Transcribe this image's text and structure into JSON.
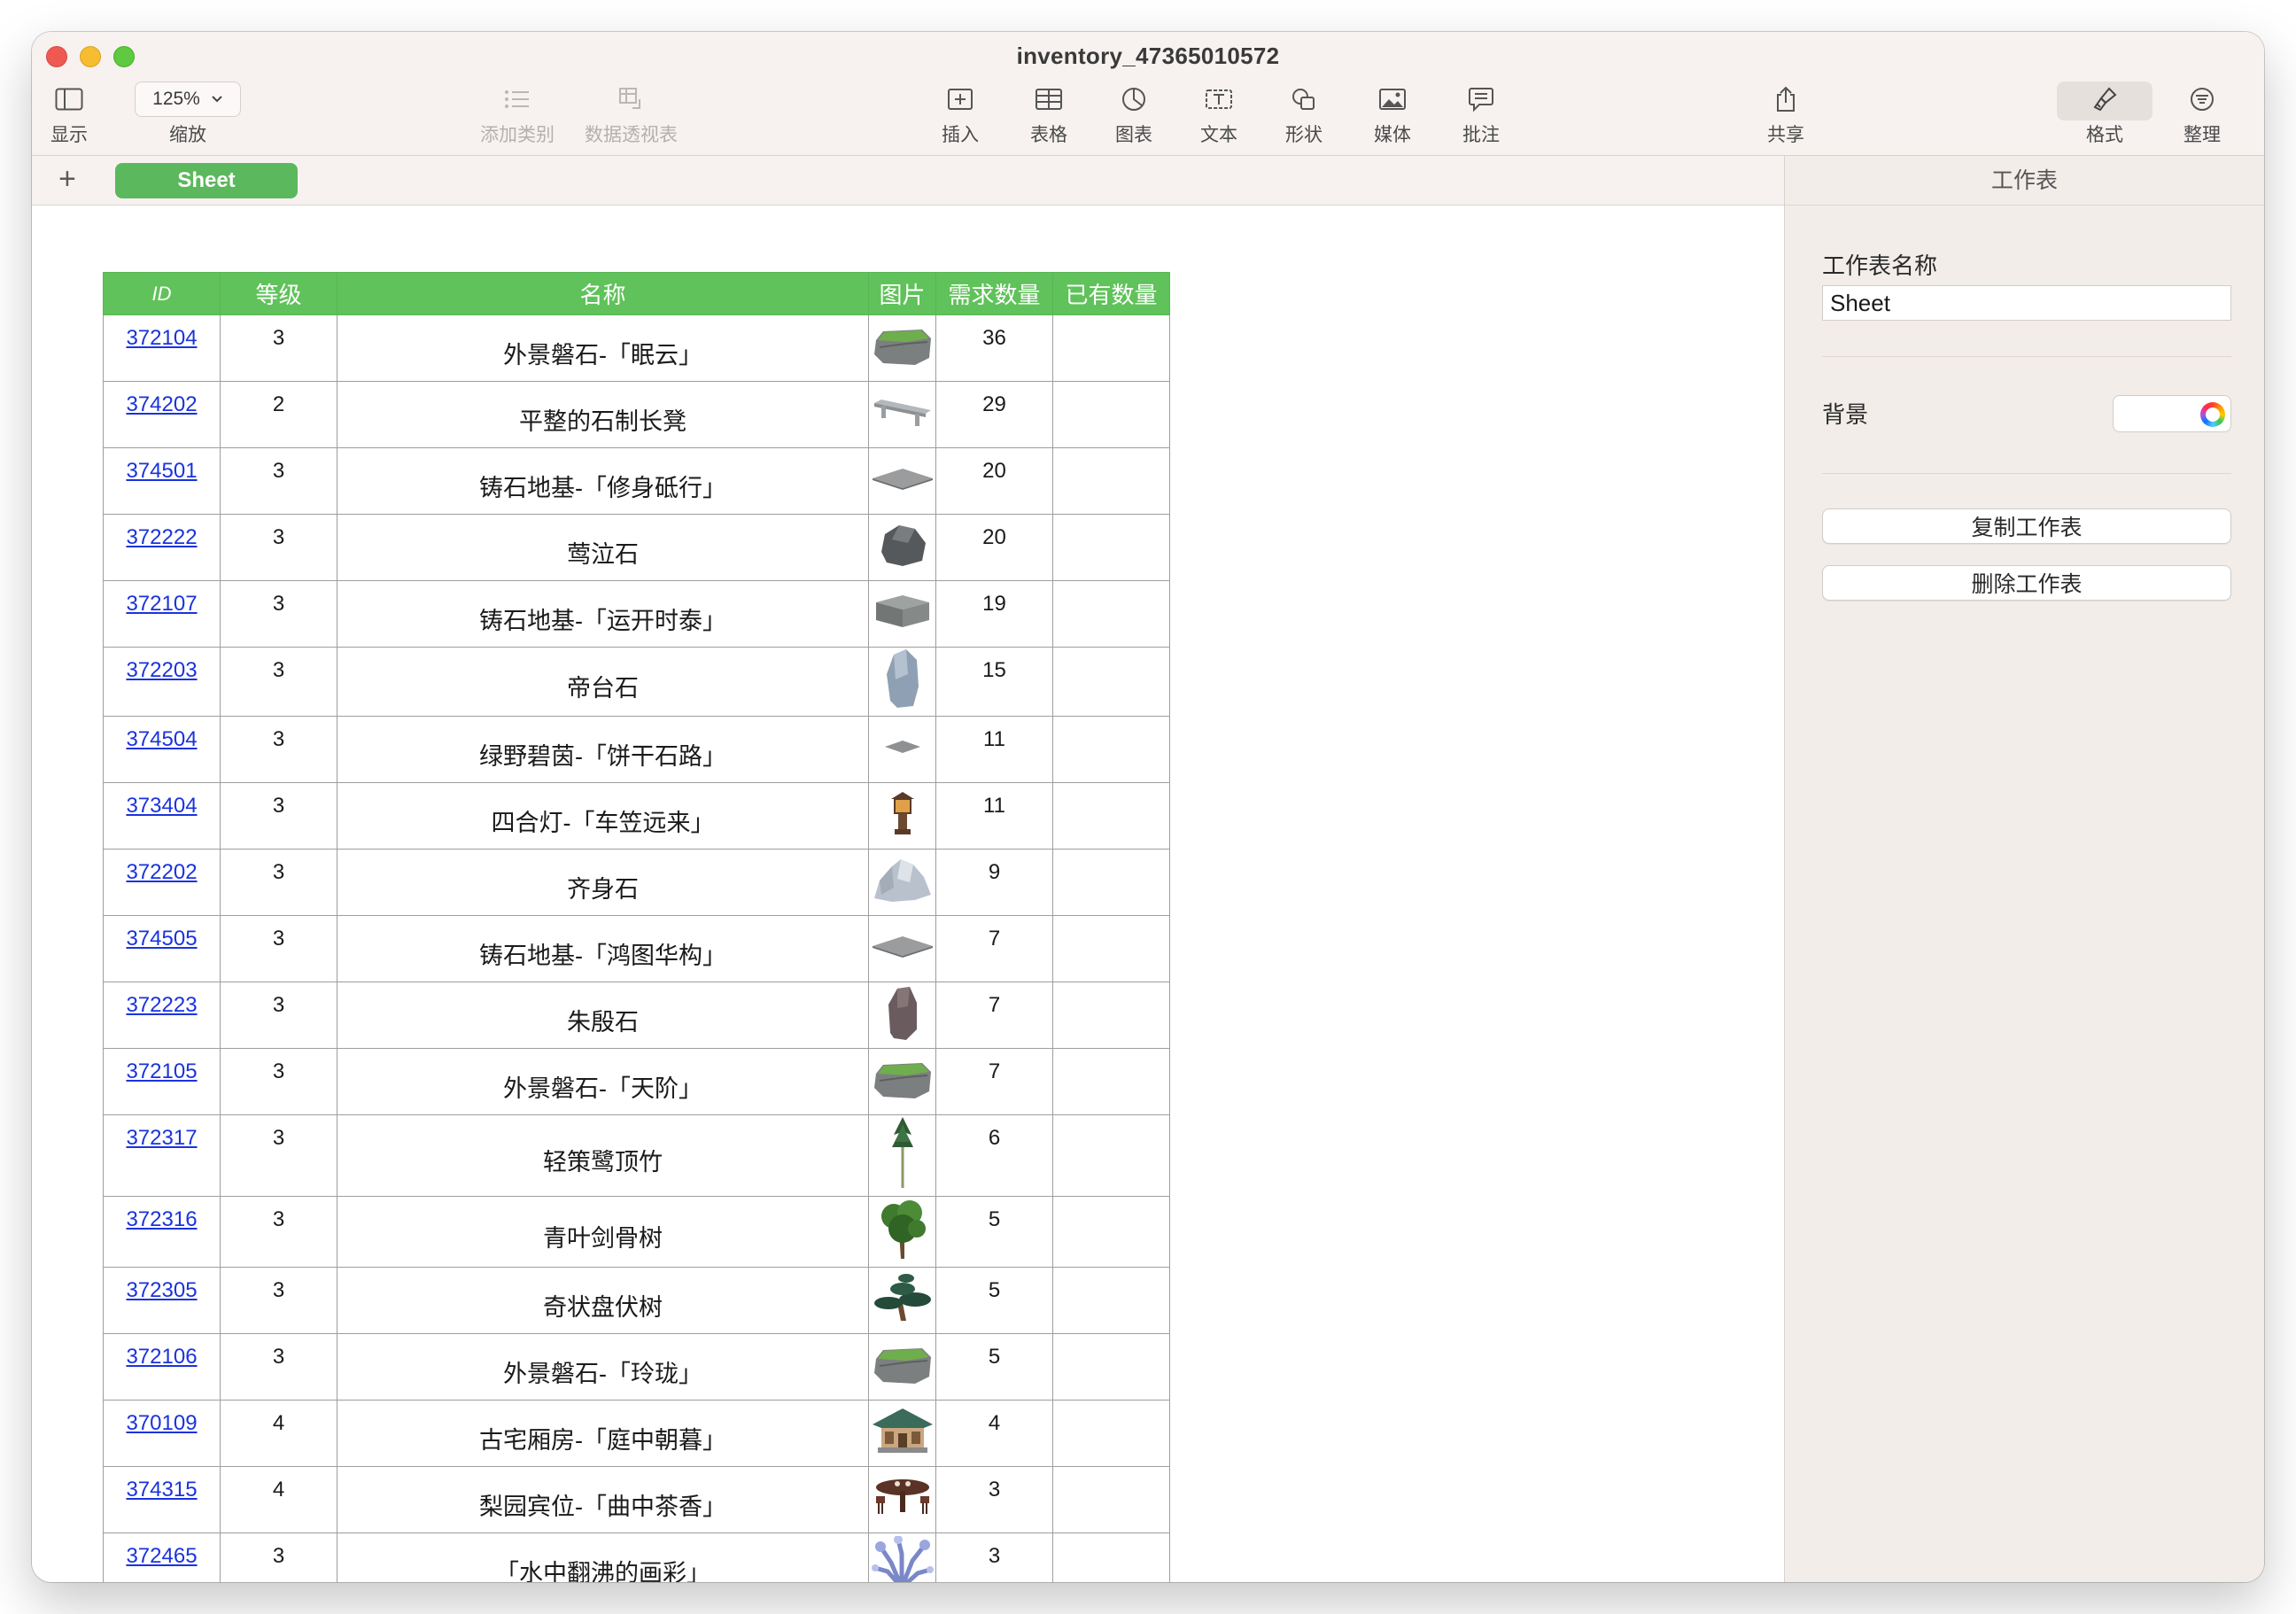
{
  "window": {
    "title": "inventory_47365010572"
  },
  "toolbar": {
    "view_label": "显示",
    "zoom_value": "125%",
    "zoom_label": "缩放",
    "add_category_label": "添加类别",
    "pivot_label": "数据透视表",
    "insert_label": "插入",
    "table_label": "表格",
    "chart_label": "图表",
    "text_label": "文本",
    "shape_label": "形状",
    "media_label": "媒体",
    "comment_label": "批注",
    "share_label": "共享",
    "format_label": "格式",
    "organize_label": "整理"
  },
  "tabs": {
    "add": "+",
    "sheet_name": "Sheet"
  },
  "table": {
    "headers": [
      "ID",
      "等级",
      "名称",
      "图片",
      "需求数量",
      "已有数量"
    ],
    "rows": [
      {
        "id": "372104",
        "level": "3",
        "name": "外景磐石-「眠云」",
        "demand": "36",
        "owned": "",
        "icon": "mossy-rock"
      },
      {
        "id": "374202",
        "level": "2",
        "name": "平整的石制长凳",
        "demand": "29",
        "owned": "",
        "icon": "stone-bench"
      },
      {
        "id": "374501",
        "level": "3",
        "name": "铸石地基-「修身砥行」",
        "demand": "20",
        "owned": "",
        "icon": "floor-tile"
      },
      {
        "id": "372222",
        "level": "3",
        "name": "莺泣石",
        "demand": "20",
        "owned": "",
        "icon": "dark-boulder"
      },
      {
        "id": "372107",
        "level": "3",
        "name": "铸石地基-「运开时泰」",
        "demand": "19",
        "owned": "",
        "icon": "stone-block"
      },
      {
        "id": "372203",
        "level": "3",
        "name": "帝台石",
        "demand": "15",
        "owned": "",
        "icon": "tall-stone"
      },
      {
        "id": "374504",
        "level": "3",
        "name": "绿野碧茵-「饼干石路」",
        "demand": "11",
        "owned": "",
        "icon": "small-tile"
      },
      {
        "id": "373404",
        "level": "3",
        "name": "四合灯-「车笠远来」",
        "demand": "11",
        "owned": "",
        "icon": "lantern"
      },
      {
        "id": "372202",
        "level": "3",
        "name": "齐身石",
        "demand": "9",
        "owned": "",
        "icon": "white-rock"
      },
      {
        "id": "374505",
        "level": "3",
        "name": "铸石地基-「鸿图华构」",
        "demand": "7",
        "owned": "",
        "icon": "floor-tile"
      },
      {
        "id": "372223",
        "level": "3",
        "name": "朱殷石",
        "demand": "7",
        "owned": "",
        "icon": "red-stone"
      },
      {
        "id": "372105",
        "level": "3",
        "name": "外景磐石-「天阶」",
        "demand": "7",
        "owned": "",
        "icon": "mossy-rock"
      },
      {
        "id": "372317",
        "level": "3",
        "name": "轻策鹭顶竹",
        "demand": "6",
        "owned": "",
        "icon": "bamboo"
      },
      {
        "id": "372316",
        "level": "3",
        "name": "青叶剑骨树",
        "demand": "5",
        "owned": "",
        "icon": "tree"
      },
      {
        "id": "372305",
        "level": "3",
        "name": "奇状盘伏树",
        "demand": "5",
        "owned": "",
        "icon": "pine"
      },
      {
        "id": "372106",
        "level": "3",
        "name": "外景磐石-「玲珑」",
        "demand": "5",
        "owned": "",
        "icon": "mossy-rock"
      },
      {
        "id": "370109",
        "level": "4",
        "name": "古宅厢房-「庭中朝暮」",
        "demand": "4",
        "owned": "",
        "icon": "house"
      },
      {
        "id": "374315",
        "level": "4",
        "name": "梨园宾位-「曲中茶香」",
        "demand": "3",
        "owned": "",
        "icon": "tea-table"
      },
      {
        "id": "372465",
        "level": "3",
        "name": "「水中翻沸的画彩」",
        "demand": "3",
        "owned": "",
        "icon": "coral"
      }
    ]
  },
  "sidebar": {
    "header": "工作表",
    "sheet_name_label": "工作表名称",
    "sheet_name_value": "Sheet",
    "background_label": "背景",
    "duplicate_label": "复制工作表",
    "delete_label": "删除工作表"
  }
}
